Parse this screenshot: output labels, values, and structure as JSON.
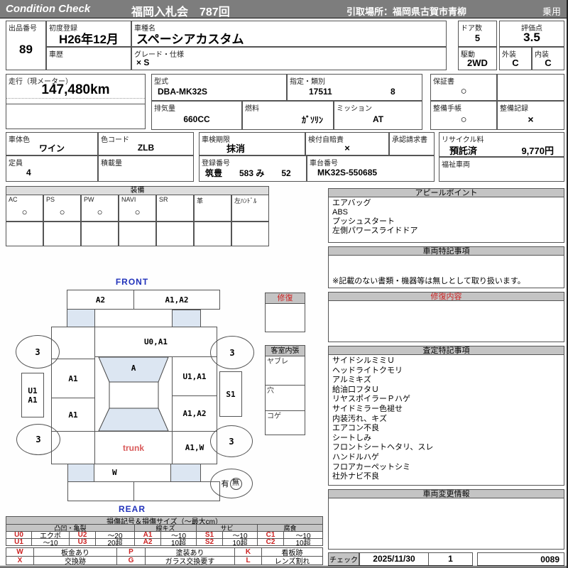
{
  "colors": {
    "header_bg": "#7d7d7d",
    "section_header_bg": "#c4c4c4",
    "accent_red": "#cc2222",
    "direction_blue": "#2233bb",
    "glass_blue": "#dce6f2"
  },
  "header": {
    "brand": "Condition  Check",
    "auction": "福岡入札会　787回",
    "pickup": "引取場所：福岡県古賀市青柳",
    "usage": "乗用"
  },
  "top": {
    "lot_label": "出品番号",
    "lot_value": "89",
    "first_reg_label": "初度登録",
    "first_reg_value": "H26年12月",
    "history_label": "車歴",
    "model_label": "車種名",
    "model_value": "スペーシアカスタム",
    "grade_label": "グレード・仕様",
    "grade_value": "× S",
    "doors_label": "ドア数",
    "doors_value": "5",
    "drive_label": "駆動",
    "drive_value": "2WD",
    "score_label": "評価点",
    "score_value": "3.5",
    "ext_label": "外装",
    "ext_value": "C",
    "int_label": "内装",
    "int_value": "C"
  },
  "spec": {
    "mileage_label": "走行（現メーター）",
    "mileage_value": "147,480km",
    "model_code_label": "型式",
    "model_code_value": "DBA-MK32S",
    "class_label": "指定・類別",
    "class_no": "17511",
    "class_sub": "8",
    "warranty_label": "保証書",
    "warranty_value": "○",
    "disp_label": "排気量",
    "disp_value": "660CC",
    "fuel_label": "燃料",
    "fuel_value": "ｶﾞｿﾘﾝ",
    "mission_label": "ミッション",
    "mission_value": "AT",
    "book_label": "整備手帳",
    "book_value": "○",
    "record_label": "整備記録",
    "record_value": "×"
  },
  "reg": {
    "body_color_label": "車体色",
    "body_color_value": "ワイン",
    "color_code_label": "色コード",
    "color_code_value": "ZLB",
    "shaken_label": "車検期限",
    "shaken_value": "抹消",
    "jibai_label": "検付自賠責",
    "jibai_value": "×",
    "approval_label": "承認請求書",
    "capacity_label": "定員",
    "capacity_value": "4",
    "payload_label": "積載量",
    "plate_label": "登録番号",
    "plate_value": "筑豊　　583 み　　52",
    "vin_label": "車台番号",
    "vin_value": "MK32S-550685",
    "recycle_label": "リサイクル料",
    "recycle_status": "預託済",
    "recycle_fee": "9,770円",
    "welfare_label": "福祉車両"
  },
  "equipment": {
    "title": "装備",
    "items": [
      {
        "label": "AC",
        "value": "○"
      },
      {
        "label": "PS",
        "value": "○"
      },
      {
        "label": "PW",
        "value": "○"
      },
      {
        "label": "NAVI",
        "value": "○"
      },
      {
        "label": "SR",
        "value": ""
      },
      {
        "label": "革",
        "value": ""
      },
      {
        "label": "左ﾊﾝﾄﾞﾙ",
        "value": ""
      }
    ]
  },
  "appeal": {
    "title": "アピールポイント",
    "items": [
      "エアバッグ",
      "ABS",
      "プッシュスタート",
      "左側パワースライドドア"
    ]
  },
  "notes": {
    "title": "車両特記事項",
    "disclaimer": "※記載のない書類・機器等は無しとして取り扱います。"
  },
  "repair": {
    "title": "修復内容"
  },
  "assessment": {
    "title": "査定特記事項",
    "items": [
      "サイドシルミミＵ",
      "ヘッドライトクモリ",
      "アルミキズ",
      "給油口フタＵ",
      "リヤスポイラーＰハゲ",
      "サイドミラー色褪せ",
      "内装汚れ、キズ",
      "エアコン不良",
      "シートしみ",
      "フロントシートヘタリ、スレ",
      "ハンドルハゲ",
      "フロアカーペットシミ",
      "社外ナビ不良"
    ]
  },
  "change": {
    "title": "車両変更情報"
  },
  "check": {
    "label": "チェック",
    "date": "2025/11/30",
    "count": "1",
    "sheet_no": "0089"
  },
  "diagram": {
    "front_label": "FRONT",
    "rear_label": "REAR",
    "front_bumper_left": "A2",
    "front_bumper_right": "A1,A2",
    "hood": "U0,A1",
    "windshield": "A",
    "left_front_door": "A1",
    "left_rear_door": "A1",
    "left_sill_top": "U1",
    "left_sill_bottom": "A1",
    "right_front_door": "U1,A1",
    "right_rear_door": "A1,A2",
    "right_quarter": "A1,W",
    "right_sill": "S1",
    "trunk": "trunk",
    "back_panel": "W",
    "wheel_fl": "3",
    "wheel_fr": "3",
    "wheel_rl": "3",
    "wheel_rr": "3",
    "recycle_yes": "有",
    "recycle_no": "無",
    "repair_box_title": "修復",
    "interior_title": "客室内張",
    "interior_tear": "ヤブレ",
    "interior_hole": "穴",
    "interior_burn": "コゲ"
  },
  "legend": {
    "title": "損傷記号＆損傷サイズ（～最大cm）",
    "group1": "凸凹・亀裂",
    "group2": "線キズ",
    "group3": "サビ",
    "group4": "腐食",
    "u0": "U0",
    "u0_desc": "エクボ",
    "u2": "U2",
    "u2_desc": "～20",
    "u1": "U1",
    "u1_desc": "～10",
    "u3": "U3",
    "u3_desc": "20超",
    "a1": "A1",
    "a1_desc": "～10",
    "a2": "A2",
    "a2_desc": "10超",
    "s1": "S1",
    "s1_desc": "～10",
    "s2": "S2",
    "s2_desc": "10超",
    "c1": "C1",
    "c1_desc": "～10",
    "c2": "C2",
    "c2_desc": "10超",
    "w": "W",
    "w_desc": "板金あり",
    "p": "P",
    "p_desc": "塗装あり",
    "k": "K",
    "k_desc": "看板跡",
    "x": "X",
    "x_desc": "交換跡",
    "g": "G",
    "g_desc": "ガラス交換要す",
    "l": "L",
    "l_desc": "レンズ割れ"
  }
}
